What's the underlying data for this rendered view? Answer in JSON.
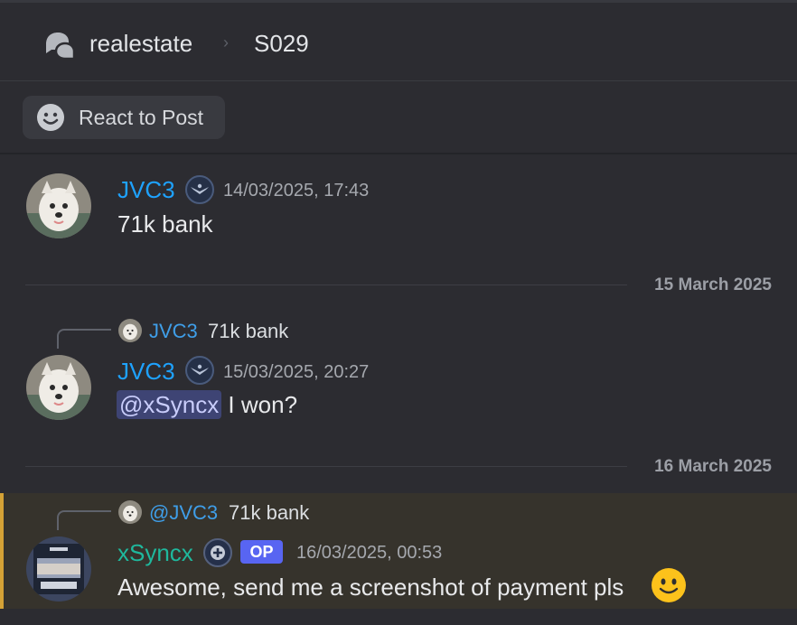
{
  "header": {
    "channel": "realestate",
    "separator": "›",
    "thread": "S029",
    "forum_icon": "forum-icon"
  },
  "react_button": {
    "label": "React to Post",
    "icon": "smile-icon"
  },
  "messages": [
    {
      "author": "JVC3",
      "badge": "eagle-badge-icon",
      "timestamp": "14/03/2025, 17:43",
      "content": "71k bank"
    },
    {
      "reply": {
        "author": "JVC3",
        "text": "71k bank"
      },
      "author": "JVC3",
      "badge": "eagle-badge-icon",
      "timestamp": "15/03/2025, 20:27",
      "mention": "@xSyncx",
      "content": " I won?"
    },
    {
      "reply": {
        "author": "@JVC3",
        "text": "71k bank"
      },
      "author": "xSyncx",
      "badge": "plus-badge-icon",
      "tag": "OP",
      "timestamp": "16/03/2025, 00:53",
      "content": "Awesome, send me a screenshot of payment pls",
      "emoji": "slightly-smiling-face"
    }
  ],
  "date_separators": [
    "15 March 2025",
    "16 March 2025"
  ],
  "colors": {
    "background": "#2c2c31",
    "jvc_name": "#1ea2ff",
    "xsyncx_name": "#1fb89d",
    "op_tag": "#5865f2",
    "mention_bg": "#3e4474",
    "highlight_bar": "#d4a236"
  }
}
